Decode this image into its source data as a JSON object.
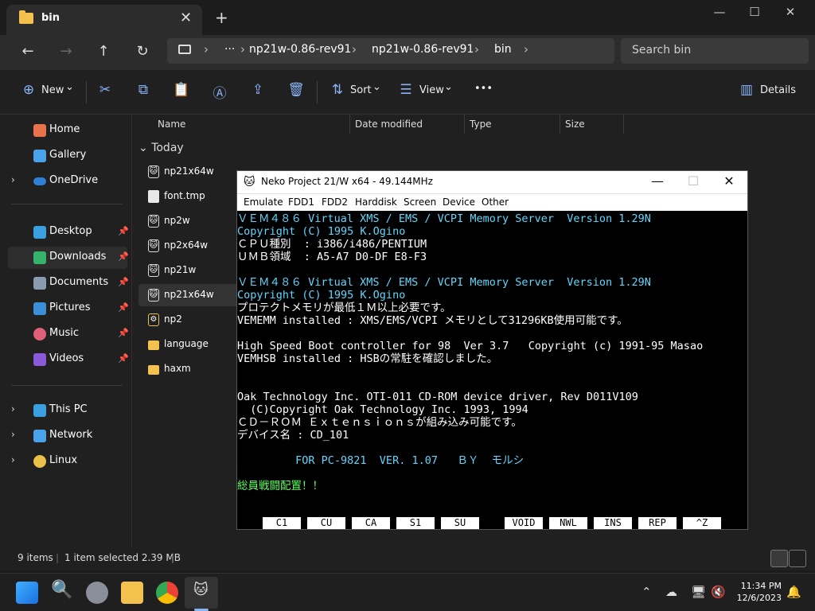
{
  "explorer": {
    "tab_title": "bin",
    "tab_close": "✕",
    "tab_add": "+",
    "window_controls": {
      "minimize": "—",
      "maximize": "☐",
      "close": "✕"
    },
    "nav": {
      "back": "←",
      "forward": "→",
      "up": "↑",
      "refresh": "↻"
    },
    "address": {
      "ellipsis": "···",
      "segments": [
        "np21w-0.86-rev91",
        "np21w-0.86-rev91",
        "bin"
      ],
      "chevron": "›"
    },
    "search_placeholder": "Search bin",
    "toolbar": {
      "new_label": "New",
      "sort_label": "Sort",
      "view_label": "View",
      "more": "•••",
      "details_label": "Details",
      "caret": "⌄"
    },
    "sidebar": [
      {
        "label": "Home",
        "icon": "home-icon",
        "color": "#e8734a"
      },
      {
        "label": "Gallery",
        "icon": "gallery-icon",
        "color": "#4aa3e8"
      },
      {
        "label": "OneDrive",
        "icon": "onedrive-icon",
        "color": "#2f7fd6",
        "expand": "›"
      },
      {
        "label": "Desktop",
        "icon": "desktop-icon",
        "color": "#3aa0e0",
        "pin": "📌"
      },
      {
        "label": "Downloads",
        "icon": "downloads-icon",
        "color": "#35b36b",
        "pin": "📌"
      },
      {
        "label": "Documents",
        "icon": "documents-icon",
        "color": "#8a9bb0",
        "pin": "📌"
      },
      {
        "label": "Pictures",
        "icon": "pictures-icon",
        "color": "#3a8fd6",
        "pin": "📌"
      },
      {
        "label": "Music",
        "icon": "music-icon",
        "color": "#e0607a",
        "pin": "📌"
      },
      {
        "label": "Videos",
        "icon": "videos-icon",
        "color": "#8a5ad6",
        "pin": "📌"
      },
      {
        "label": "This PC",
        "icon": "this-pc-icon",
        "color": "#3aa0e0",
        "expand": "›"
      },
      {
        "label": "Network",
        "icon": "network-icon",
        "color": "#4aa3e8",
        "expand": "›"
      },
      {
        "label": "Linux",
        "icon": "linux-icon",
        "color": "#e8c04a",
        "expand": "›"
      }
    ],
    "columns": {
      "name": "Name",
      "date": "Date modified",
      "type": "Type",
      "size": "Size"
    },
    "group_label": "Today",
    "group_chev": "⌄",
    "files": [
      {
        "name": "np21x64w",
        "kind": "cat"
      },
      {
        "name": "font.tmp",
        "kind": "doc"
      },
      {
        "name": "np2w",
        "kind": "cat"
      },
      {
        "name": "np2x64w",
        "kind": "cat"
      },
      {
        "name": "np21w",
        "kind": "cat"
      },
      {
        "name": "np21x64w",
        "kind": "cat"
      },
      {
        "name": "np2",
        "kind": "cat"
      },
      {
        "name": "language",
        "kind": "folder"
      },
      {
        "name": "haxm",
        "kind": "folder"
      }
    ],
    "status": {
      "items": "9 items",
      "selected": "1 item selected  2.39 MB"
    }
  },
  "neko": {
    "title": "Neko Project 21/W x64 - 49.144MHz",
    "menu": [
      "Emulate",
      "FDD1",
      "FDD2",
      "Harddisk",
      "Screen",
      "Device",
      "Other"
    ],
    "screen_lines": [
      {
        "text": "ＶＥＭ４８６ Virtual XMS / EMS / VCPI Memory Server  Version 1.29N",
        "color": "cyan"
      },
      {
        "text": "Copyright (C) 1995 K.Ogino",
        "color": "cyan"
      },
      {
        "text": "ＣＰＵ種別  : i386/i486/PENTIUM",
        "color": "white"
      },
      {
        "text": "ＵＭＢ領域  : A5-A7 D0-DF E8-F3",
        "color": "white"
      },
      {
        "text": "",
        "color": "white"
      },
      {
        "text": "ＶＥＭ４８６ Virtual XMS / EMS / VCPI Memory Server  Version 1.29N",
        "color": "cyan"
      },
      {
        "text": "Copyright (C) 1995 K.Ogino",
        "color": "cyan"
      },
      {
        "text": "プロテクトメモリが最低１Ｍ以上必要です。",
        "color": "white"
      },
      {
        "text": "VEMEMM installed : XMS/EMS/VCPI メモリとして31296KB使用可能です。",
        "color": "white"
      },
      {
        "text": "",
        "color": "white"
      },
      {
        "text": "High Speed Boot controller for 98  Ver 3.7   Copyright (c) 1991-95 Masao",
        "color": "white"
      },
      {
        "text": "VEMHSB installed : HSBの常駐を確認しました。",
        "color": "white"
      },
      {
        "text": "",
        "color": "white"
      },
      {
        "text": "",
        "color": "white"
      },
      {
        "text": "Oak Technology Inc. OTI-011 CD-ROM device driver, Rev D011V109",
        "color": "white"
      },
      {
        "text": "  (C)Copyright Oak Technology Inc. 1993, 1994",
        "color": "white"
      },
      {
        "text": "ＣＤ－ＲＯＭ Ｅｘｔｅｎｓｉｏｎｓが組み込み可能です。",
        "color": "white"
      },
      {
        "text": "デバイス名 : CD_101",
        "color": "white"
      },
      {
        "text": "",
        "color": "white"
      },
      {
        "text": "         FOR PC-9821  VER. 1.07   ＢＹ  モルシ",
        "color": "cyan"
      },
      {
        "text": "",
        "color": "white"
      },
      {
        "text": "総員戦闘配置！！",
        "color": "green"
      }
    ],
    "fkeys": [
      "C1",
      "CU",
      "CA",
      "S1",
      "SU",
      "VOID",
      "NWL",
      "INS",
      "REP",
      "^Z"
    ]
  },
  "taskbar": {
    "clock_time": "11:34 PM",
    "clock_date": "12/6/2023"
  }
}
